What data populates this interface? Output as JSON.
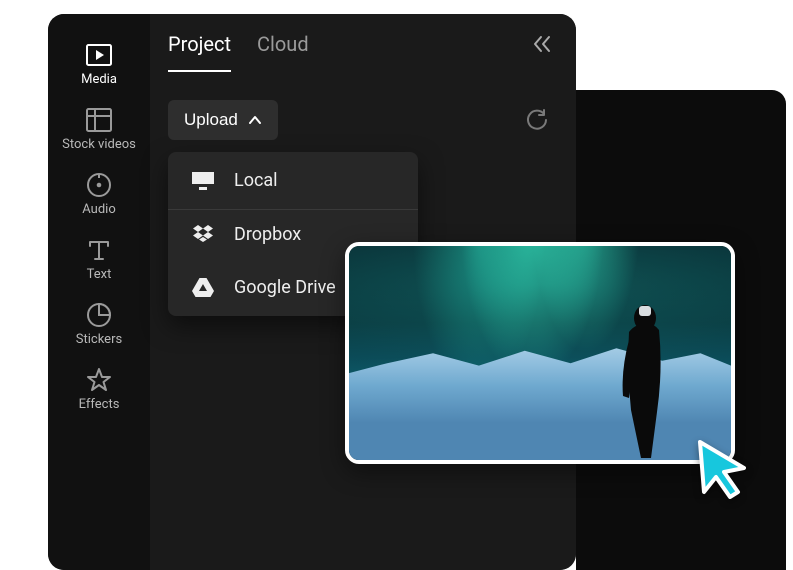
{
  "sidebar": {
    "items": [
      {
        "label": "Media"
      },
      {
        "label": "Stock videos"
      },
      {
        "label": "Audio"
      },
      {
        "label": "Text"
      },
      {
        "label": "Stickers"
      },
      {
        "label": "Effects"
      }
    ]
  },
  "tabs": {
    "project": "Project",
    "cloud": "Cloud"
  },
  "toolbar": {
    "upload_label": "Upload"
  },
  "upload_menu": {
    "local": "Local",
    "dropbox": "Dropbox",
    "google_drive": "Google Drive"
  }
}
